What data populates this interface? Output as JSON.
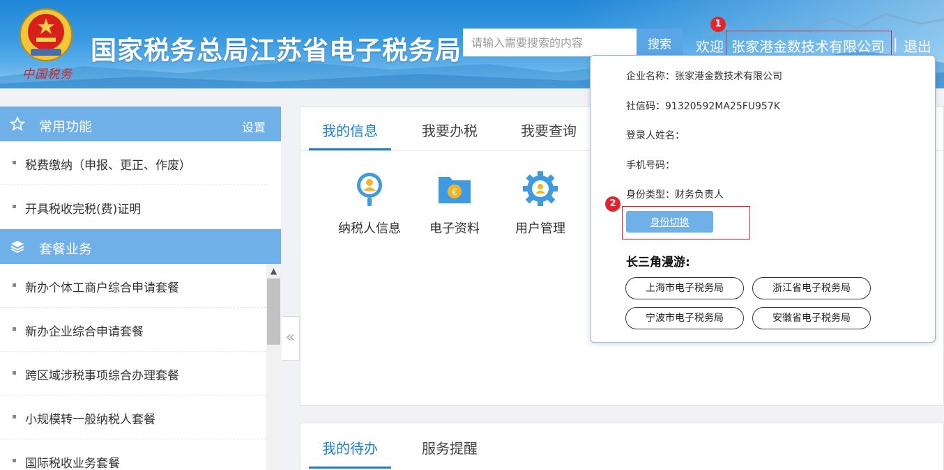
{
  "header": {
    "emblem_caption": "中国税务",
    "site_title": "国家税务总局江苏省电子税务局",
    "search": {
      "placeholder": "请输入需要搜索的内容",
      "button": "搜索"
    },
    "welcome": "欢迎",
    "company": "张家港金数技术有限公司",
    "separator": "|",
    "logout": "退出"
  },
  "badges": {
    "one": "1",
    "two": "2"
  },
  "sidebar": {
    "sections": [
      {
        "title": "常用功能",
        "action": "设置",
        "icon": "star-icon",
        "items": [
          "税费缴纳（申报、更正、作废）",
          "开具税收完税(费)证明"
        ]
      },
      {
        "title": "套餐业务",
        "icon": "layers-icon",
        "items": [
          "新办个体工商户综合申请套餐",
          "新办企业综合申请套餐",
          "跨区域涉税事项综合办理套餐",
          "小规模转一般纳税人套餐",
          "国际税收业务套餐"
        ]
      }
    ]
  },
  "main": {
    "tabs": [
      "我的信息",
      "我要办税",
      "我要查询"
    ],
    "functions": [
      {
        "label": "纳税人信息",
        "icon": "taxpayer-info-icon"
      },
      {
        "label": "电子资料",
        "icon": "electronic-data-icon"
      },
      {
        "label": "用户管理",
        "icon": "user-management-icon"
      }
    ],
    "bottom_tabs": [
      "我的待办",
      "服务提醒"
    ]
  },
  "popup": {
    "company_label": "企业名称：张家港金数技术有限公司",
    "credit_code": "社信码：91320592MA25FU957K",
    "login_name": "登录人姓名：",
    "phone": "手机号码：",
    "identity_type": "身份类型：财务负责人",
    "switch_button": "身份切换",
    "roam_title": "长三角漫游:",
    "roam_links": [
      "上海市电子税务局",
      "浙江省电子税务局",
      "宁波市电子税务局",
      "安徽省电子税务局"
    ]
  },
  "colors": {
    "accent": "#1a7fd0",
    "sidebar_head": "#6fb0e9",
    "highlight": "#e1252c"
  }
}
